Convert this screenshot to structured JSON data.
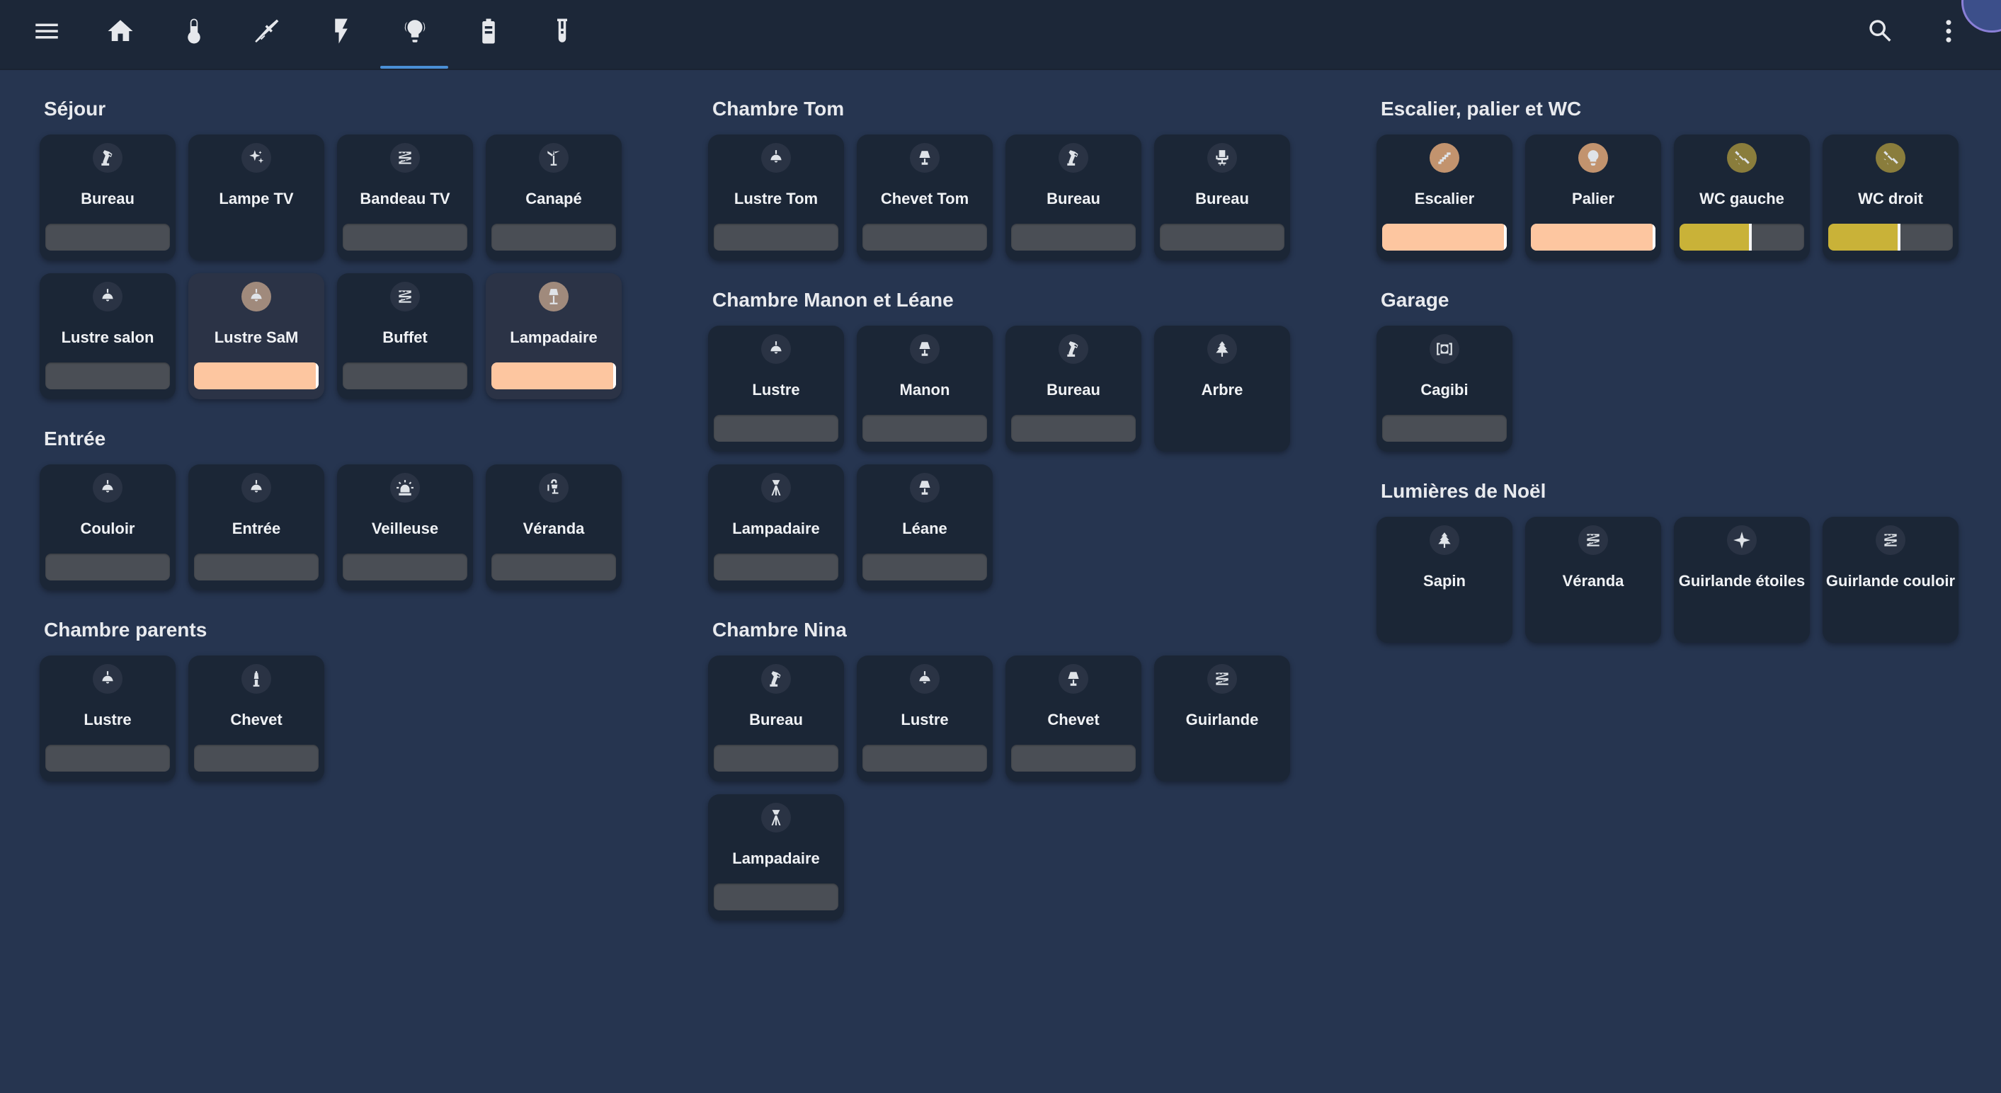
{
  "colors": {
    "background": "#263550",
    "topbar": "#1c2738",
    "card": "#1b2636",
    "slider_off": "#4a4e55",
    "peach": "#fdc6a0",
    "yellow": "#c9b238",
    "tab_accent": "#4a8fd6"
  },
  "topbar": {
    "tabs": [
      {
        "icon": "menu-icon"
      },
      {
        "icon": "home-icon"
      },
      {
        "icon": "thermometer-icon"
      },
      {
        "icon": "broom-icon"
      },
      {
        "icon": "flash-icon"
      },
      {
        "icon": "lightbulb-group-icon",
        "active": true
      },
      {
        "icon": "battery-icon"
      },
      {
        "icon": "test-tube-icon"
      }
    ],
    "actions": [
      {
        "icon": "search-icon"
      },
      {
        "icon": "more-vertical-icon"
      }
    ]
  },
  "sections": {
    "sejour": {
      "title": "Séjour",
      "cards": [
        {
          "label": "Bureau",
          "icon": "desk-lamp-icon",
          "brightness": 0
        },
        {
          "label": "Lampe TV",
          "icon": "sparkles-icon"
        },
        {
          "label": "Bandeau TV",
          "icon": "led-strip-icon",
          "brightness": 0
        },
        {
          "label": "Canapé",
          "icon": "floor-lamp-split-icon",
          "brightness": 0
        },
        {
          "label": "Lustre salon",
          "icon": "ceiling-light-icon",
          "brightness": 0
        },
        {
          "label": "Lustre SaM",
          "icon": "ceiling-light-icon",
          "brightness": 100,
          "color": "peach"
        },
        {
          "label": "Buffet",
          "icon": "led-strip-icon",
          "brightness": 0
        },
        {
          "label": "Lampadaire",
          "icon": "floor-lamp-icon",
          "brightness": 100,
          "color": "peach"
        }
      ]
    },
    "entree": {
      "title": "Entrée",
      "cards": [
        {
          "label": "Couloir",
          "icon": "ceiling-light-icon",
          "brightness": 0
        },
        {
          "label": "Entrée",
          "icon": "ceiling-light-icon",
          "brightness": 0
        },
        {
          "label": "Veilleuse",
          "icon": "alarm-light-icon",
          "brightness": 0
        },
        {
          "label": "Véranda",
          "icon": "wall-lamp-icon",
          "brightness": 0
        }
      ]
    },
    "parents": {
      "title": "Chambre parents",
      "cards": [
        {
          "label": "Lustre",
          "icon": "ceiling-light-icon",
          "brightness": 0
        },
        {
          "label": "Chevet",
          "icon": "bedside-lamp-icon",
          "brightness": 0
        }
      ]
    },
    "tom": {
      "title": "Chambre Tom",
      "cards": [
        {
          "label": "Lustre Tom",
          "icon": "ceiling-light-icon",
          "brightness": 0
        },
        {
          "label": "Chevet Tom",
          "icon": "table-lamp-icon",
          "brightness": 0
        },
        {
          "label": "Bureau",
          "icon": "desk-lamp-icon",
          "brightness": 0
        },
        {
          "label": "Bureau",
          "icon": "office-chair-icon",
          "brightness": 0
        }
      ]
    },
    "manon": {
      "title": "Chambre Manon et Léane",
      "cards": [
        {
          "label": "Lustre",
          "icon": "ceiling-light-icon",
          "brightness": 0
        },
        {
          "label": "Manon",
          "icon": "table-lamp-icon",
          "brightness": 0
        },
        {
          "label": "Bureau",
          "icon": "desk-lamp-icon",
          "brightness": 0
        },
        {
          "label": "Arbre",
          "icon": "pine-tree-icon"
        },
        {
          "label": "Lampadaire",
          "icon": "tripod-lamp-icon",
          "brightness": 0
        },
        {
          "label": "Léane",
          "icon": "table-lamp-icon",
          "brightness": 0
        }
      ]
    },
    "nina": {
      "title": "Chambre Nina",
      "cards": [
        {
          "label": "Bureau",
          "icon": "desk-lamp-icon",
          "brightness": 0
        },
        {
          "label": "Lustre",
          "icon": "ceiling-light-icon",
          "brightness": 0
        },
        {
          "label": "Chevet",
          "icon": "table-lamp-icon",
          "brightness": 0
        },
        {
          "label": "Guirlande",
          "icon": "led-strip-icon"
        },
        {
          "label": "Lampadaire",
          "icon": "tripod-lamp-icon",
          "brightness": 0
        }
      ]
    },
    "escalier": {
      "title": "Escalier, palier et WC",
      "cards": [
        {
          "label": "Escalier",
          "icon": "stairs-icon",
          "brightness": 100,
          "color": "peach",
          "bubble": "orange"
        },
        {
          "label": "Palier",
          "icon": "lightbulb-icon",
          "brightness": 100,
          "color": "peach",
          "bubble": "orange"
        },
        {
          "label": "WC gauche",
          "icon": "spotlight-icon",
          "brightness": 58,
          "color": "yellow",
          "bubble": "yellow"
        },
        {
          "label": "WC droit",
          "icon": "spotlight-icon",
          "brightness": 58,
          "color": "yellow",
          "bubble": "yellow"
        }
      ]
    },
    "garage": {
      "title": "Garage",
      "cards": [
        {
          "label": "Cagibi",
          "icon": "light-flood-icon",
          "brightness": 0
        }
      ]
    },
    "noel": {
      "title": "Lumières de Noël",
      "cards": [
        {
          "label": "Sapin",
          "icon": "pine-tree-icon"
        },
        {
          "label": "Véranda",
          "icon": "led-strip-icon"
        },
        {
          "label": "Guirlande étoiles",
          "icon": "star-four-points-icon"
        },
        {
          "label": "Guirlande couloir",
          "icon": "led-strip-icon"
        }
      ]
    }
  }
}
